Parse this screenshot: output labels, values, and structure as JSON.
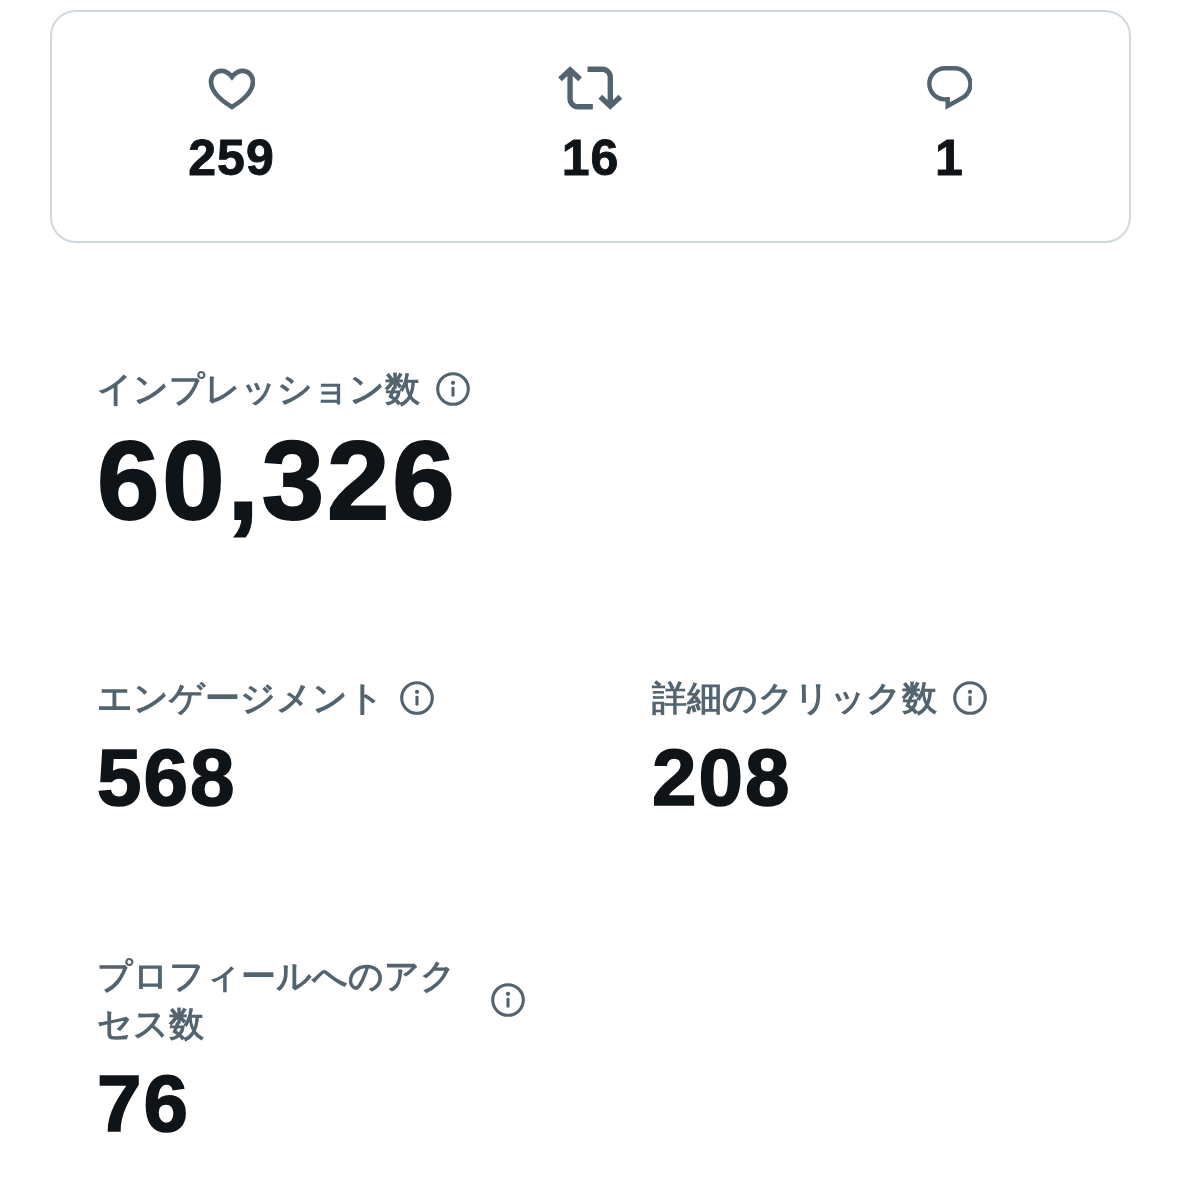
{
  "engagement_card": {
    "stats": [
      {
        "kind": "likes",
        "count": "259"
      },
      {
        "kind": "reposts",
        "count": "16"
      },
      {
        "kind": "replies",
        "count": "1"
      }
    ]
  },
  "metric_rows": [
    {
      "metrics": [
        {
          "kind": "headline",
          "label": "インプレッション数",
          "value": "60,326"
        }
      ]
    },
    {
      "metrics": [
        {
          "kind": "regular",
          "label": "エンゲージメント",
          "value": "568"
        },
        {
          "kind": "regular",
          "label": "詳細のクリック数",
          "value": "208"
        }
      ]
    },
    {
      "metrics": [
        {
          "kind": "regular",
          "label": "プロフィールへのアクセス数",
          "value": "76"
        }
      ]
    }
  ]
}
